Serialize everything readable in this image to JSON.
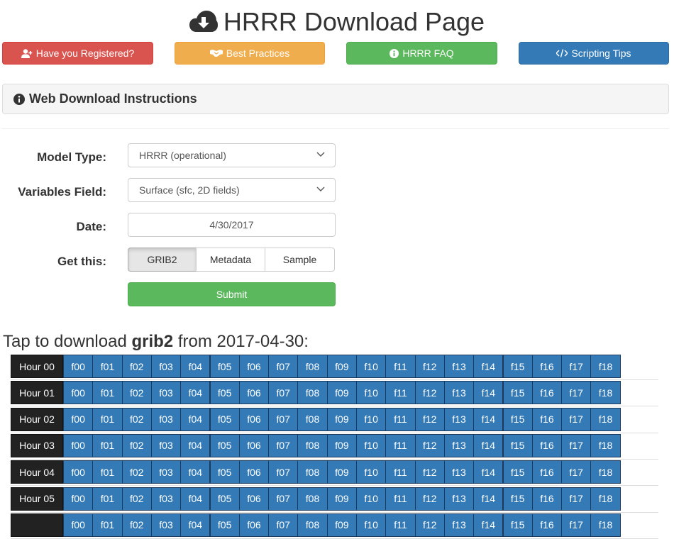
{
  "header": {
    "title": "HRRR Download Page",
    "icon": "cloud-download-icon"
  },
  "nav_buttons": [
    {
      "label": "Have you Registered?",
      "icon": "user-plus-icon",
      "color": "#d9534f"
    },
    {
      "label": "Best Practices",
      "icon": "handshake-icon",
      "color": "#f0ad4e"
    },
    {
      "label": "HRRR FAQ",
      "icon": "info-circle-icon",
      "color": "#5cb85c"
    },
    {
      "label": "Scripting Tips",
      "icon": "code-icon",
      "color": "#337ab7"
    }
  ],
  "instructions_panel": {
    "label": "Web Download Instructions",
    "icon": "info-circle-icon"
  },
  "form": {
    "model_type_label": "Model Type:",
    "model_type_value": "HRRR (operational)",
    "variables_label": "Variables Field:",
    "variables_value": "Surface (sfc, 2D fields)",
    "date_label": "Date:",
    "date_value": "4/30/2017",
    "get_this_label": "Get this:",
    "get_options": [
      "GRIB2",
      "Metadata",
      "Sample"
    ],
    "get_selected": "GRIB2",
    "submit_label": "Submit"
  },
  "download": {
    "prefix": "Tap to download ",
    "format": "grib2",
    "suffix": " from 2017-04-30:",
    "hours": [
      "Hour 00",
      "Hour 01",
      "Hour 02",
      "Hour 03",
      "Hour 04",
      "Hour 05",
      ""
    ],
    "forecasts": [
      "f00",
      "f01",
      "f02",
      "f03",
      "f04",
      "f05",
      "f06",
      "f07",
      "f08",
      "f09",
      "f10",
      "f11",
      "f12",
      "f13",
      "f14",
      "f15",
      "f16",
      "f17",
      "f18"
    ]
  },
  "colors": {
    "hour_cell": "#222222",
    "forecast_cell": "#337ab7"
  }
}
